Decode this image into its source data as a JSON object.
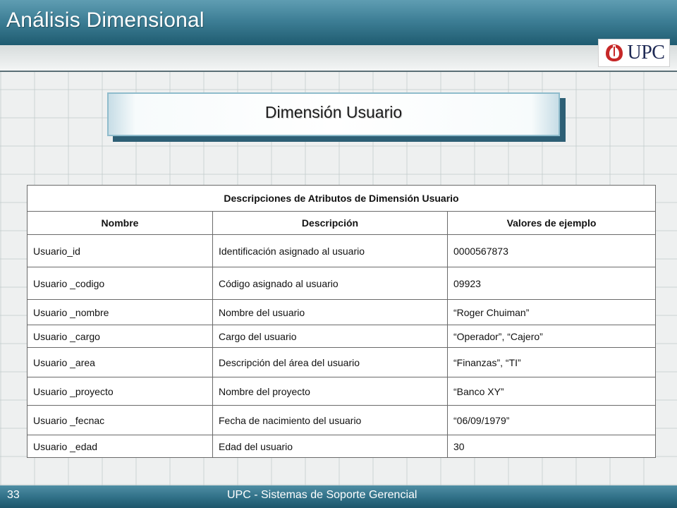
{
  "header": {
    "title": "Análisis Dimensional"
  },
  "logo": {
    "text": "UPC"
  },
  "section": {
    "title": "Dimensión Usuario"
  },
  "table": {
    "caption": "Descripciones de Atributos de Dimensión Usuario",
    "columns": [
      "Nombre",
      "Descripción",
      "Valores de ejemplo"
    ],
    "rows": [
      [
        "Usuario_id",
        "Identificación asignado al usuario",
        "0000567873"
      ],
      [
        "Usuario _codigo",
        "Código asignado al usuario",
        "09923"
      ],
      [
        "Usuario _nombre",
        "Nombre del usuario",
        "“Roger Chuiman”"
      ],
      [
        "Usuario _cargo",
        "Cargo del usuario",
        "“Operador”, “Cajero”"
      ],
      [
        "Usuario _area",
        "Descripción del área del usuario",
        "“Finanzas”, “TI”"
      ],
      [
        "Usuario _proyecto",
        "Nombre del proyecto",
        "“Banco XY”"
      ],
      [
        "Usuario _fecnac",
        "Fecha de nacimiento del usuario",
        "“06/09/1979”"
      ],
      [
        "Usuario _edad",
        "Edad del usuario",
        "30"
      ]
    ]
  },
  "footer": {
    "page_number": "33",
    "text": "UPC - Sistemas de Soporte Gerencial"
  },
  "colors": {
    "header_blue": "#3e7f96",
    "logo_navy": "#1f2a55",
    "logo_red": "#c62828"
  }
}
